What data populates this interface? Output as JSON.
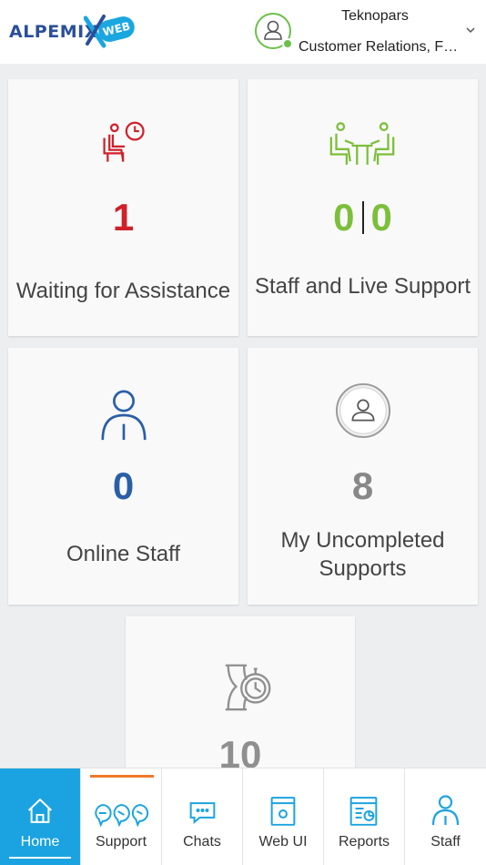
{
  "brand": {
    "logo_text": "ALPEMIX",
    "logo_badge": "WEB"
  },
  "user": {
    "name": "Teknopars",
    "department": "Customer Relations, Fi..."
  },
  "cards": {
    "waiting": {
      "value": "1",
      "label": "Waiting for Assistance",
      "color": "#d0202a"
    },
    "staff_live": {
      "value_left": "0",
      "value_right": "0",
      "label": "Staff and Live Support",
      "color": "#7cbf3a"
    },
    "online_staff": {
      "value": "0",
      "label": "Online Staff",
      "color": "#2a5fa8"
    },
    "uncompleted": {
      "value": "8",
      "label_line1": "My Uncompleted",
      "label_line2": "Supports",
      "color": "#888888"
    },
    "pending": {
      "value": "10",
      "color": "#8f8f8f"
    }
  },
  "nav": {
    "items": [
      {
        "label": "Home",
        "icon": "home-icon",
        "active": true
      },
      {
        "label": "Support",
        "icon": "support-icon"
      },
      {
        "label": "Chats",
        "icon": "chat-icon"
      },
      {
        "label": "Web UI",
        "icon": "webui-icon"
      },
      {
        "label": "Reports",
        "icon": "reports-icon"
      },
      {
        "label": "Staff",
        "icon": "staff-icon"
      }
    ],
    "accent": "#1ba3e1",
    "support_indicator": "#f07a2a"
  }
}
